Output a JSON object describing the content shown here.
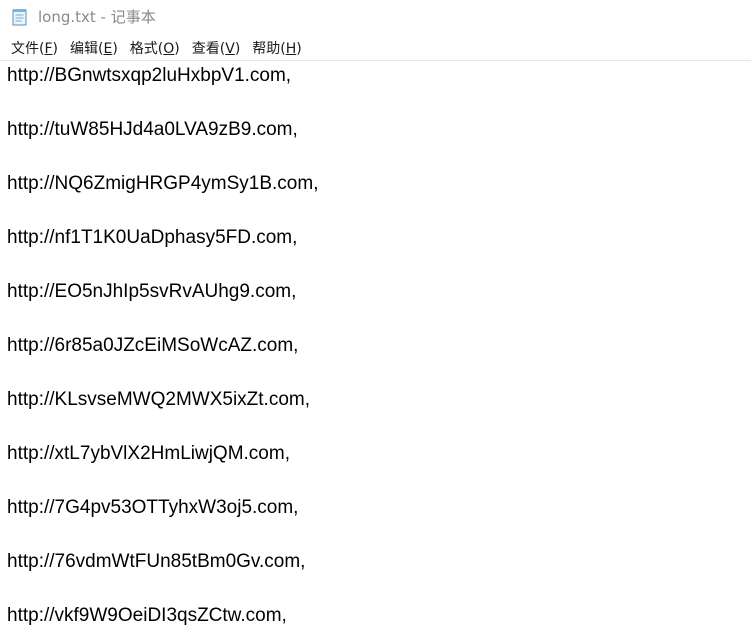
{
  "window": {
    "title": "long.txt - 记事本",
    "icon": "notepad-icon"
  },
  "menu": [
    {
      "label": "文件(",
      "key": "F",
      "suffix": ")"
    },
    {
      "label": "编辑(",
      "key": "E",
      "suffix": ")"
    },
    {
      "label": "格式(",
      "key": "O",
      "suffix": ")"
    },
    {
      "label": "查看(",
      "key": "V",
      "suffix": ")"
    },
    {
      "label": "帮助(",
      "key": "H",
      "suffix": ")"
    }
  ],
  "editor": {
    "lines": [
      "http://BGnwtsxqp2luHxbpV1.com,",
      "http://tuW85HJd4a0LVA9zB9.com,",
      "http://NQ6ZmigHRGP4ymSy1B.com,",
      "http://nf1T1K0UaDphasy5FD.com,",
      "http://EO5nJhIp5svRvAUhg9.com,",
      "http://6r85a0JZcEiMSoWcAZ.com,",
      "http://KLsvseMWQ2MWX5ixZt.com,",
      "http://xtL7ybVlX2HmLiwjQM.com,",
      "http://7G4pv53OTTyhxW3oj5.com,",
      "http://76vdmWtFUn85tBm0Gv.com,",
      "http://vkf9W9OeiDI3qsZCtw.com,"
    ]
  }
}
